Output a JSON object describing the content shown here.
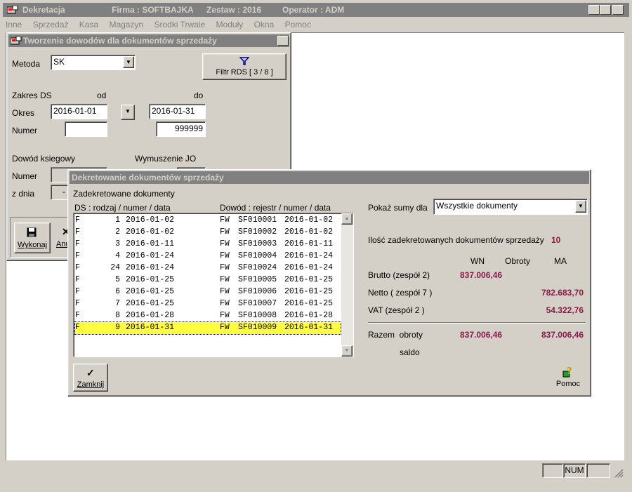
{
  "app": {
    "title": "Dekretacja",
    "firma": "Firma : SOFTBAJKA",
    "zestaw": "Zestaw : 2016",
    "operator": "Operator : ADM"
  },
  "menu": [
    "Inne",
    "Sprzedaż",
    "Kasa",
    "Magazyn",
    "Srodki Trwale",
    "Moduły",
    "Okna",
    "Pomoc"
  ],
  "tworzenie": {
    "title": "Tworzenie dowodów dla dokumentów sprzedaży",
    "metoda_label": "Metoda",
    "metoda_value": "SK",
    "filter_label": "Filtr RDS  [ 3 / 8 ]",
    "zakres_label": "Zakres DS",
    "od_label": "od",
    "do_label": "do",
    "okres_label": "Okres",
    "okres_od": "2016-01-01",
    "okres_do": "2016-01-31",
    "numer_label": "Numer",
    "numer_od": "",
    "numer_do": "999999",
    "dowod_label": "Dowód ksiegowy",
    "wymuszenie_label": "Wymuszenie JO",
    "numer2_label": "Numer",
    "zdnia_label": "z dnia",
    "zdnia_value": "-",
    "wykonaj_label": "Wykonaj",
    "anuluj_label": "Anu"
  },
  "dekretowanie": {
    "title": "Dekretowanie dokumentów sprzedaży",
    "group_label": "Zadekretowane dokumenty",
    "col_ds": "DS : rodzaj / numer / data",
    "col_dowod": "Dowód : rejestr / numer / data",
    "rows": [
      {
        "rodzaj": "F",
        "numer": "1",
        "data": "2016-01-02",
        "rejestr": "FW",
        "dnumer": "SF010001",
        "ddata": "2016-01-02"
      },
      {
        "rodzaj": "F",
        "numer": "2",
        "data": "2016-01-02",
        "rejestr": "FW",
        "dnumer": "SF010002",
        "ddata": "2016-01-02"
      },
      {
        "rodzaj": "F",
        "numer": "3",
        "data": "2016-01-11",
        "rejestr": "FW",
        "dnumer": "SF010003",
        "ddata": "2016-01-11"
      },
      {
        "rodzaj": "F",
        "numer": "4",
        "data": "2016-01-24",
        "rejestr": "FW",
        "dnumer": "SF010004",
        "ddata": "2016-01-24"
      },
      {
        "rodzaj": "F",
        "numer": "24",
        "data": "2016-01-24",
        "rejestr": "FW",
        "dnumer": "SF010024",
        "ddata": "2016-01-24"
      },
      {
        "rodzaj": "F",
        "numer": "5",
        "data": "2016-01-25",
        "rejestr": "FW",
        "dnumer": "SF010005",
        "ddata": "2016-01-25"
      },
      {
        "rodzaj": "F",
        "numer": "6",
        "data": "2016-01-25",
        "rejestr": "FW",
        "dnumer": "SF010006",
        "ddata": "2016-01-25"
      },
      {
        "rodzaj": "F",
        "numer": "7",
        "data": "2016-01-25",
        "rejestr": "FW",
        "dnumer": "SF010007",
        "ddata": "2016-01-25"
      },
      {
        "rodzaj": "F",
        "numer": "8",
        "data": "2016-01-28",
        "rejestr": "FW",
        "dnumer": "SF010008",
        "ddata": "2016-01-28"
      },
      {
        "rodzaj": "F",
        "numer": "9",
        "data": "2016-01-31",
        "rejestr": "FW",
        "dnumer": "SF010009",
        "ddata": "2016-01-31",
        "selected": true
      }
    ],
    "pokaz_label": "Pokaż sumy dla",
    "pokaz_value": "Wszystkie dokumenty",
    "ilosc_label": "Ilość zadekretowanych dokumentów sprzedaży",
    "ilosc_value": "10",
    "hdr_wn": "WN",
    "hdr_obroty": "Obroty",
    "hdr_ma": "MA",
    "brutto_label": "Brutto (zespół 2)",
    "brutto_wn": "837.006,46",
    "netto_label": "Netto ( zespół 7 )",
    "netto_ma": "782.683,70",
    "vat_label": "VAT (zespół 2 )",
    "vat_ma": "54.322,76",
    "razem_label": "Razem  obroty",
    "razem_wn": "837.006,46",
    "razem_ma": "837.006,46",
    "saldo_label": "saldo",
    "zamknij_label": "Zamknij",
    "pomoc_label": "Pomoc"
  },
  "status": {
    "num": "NUM"
  },
  "colors": {
    "titlebar": "#808080",
    "selected_row": "#ffff40",
    "amount": "#8b1a4a"
  }
}
